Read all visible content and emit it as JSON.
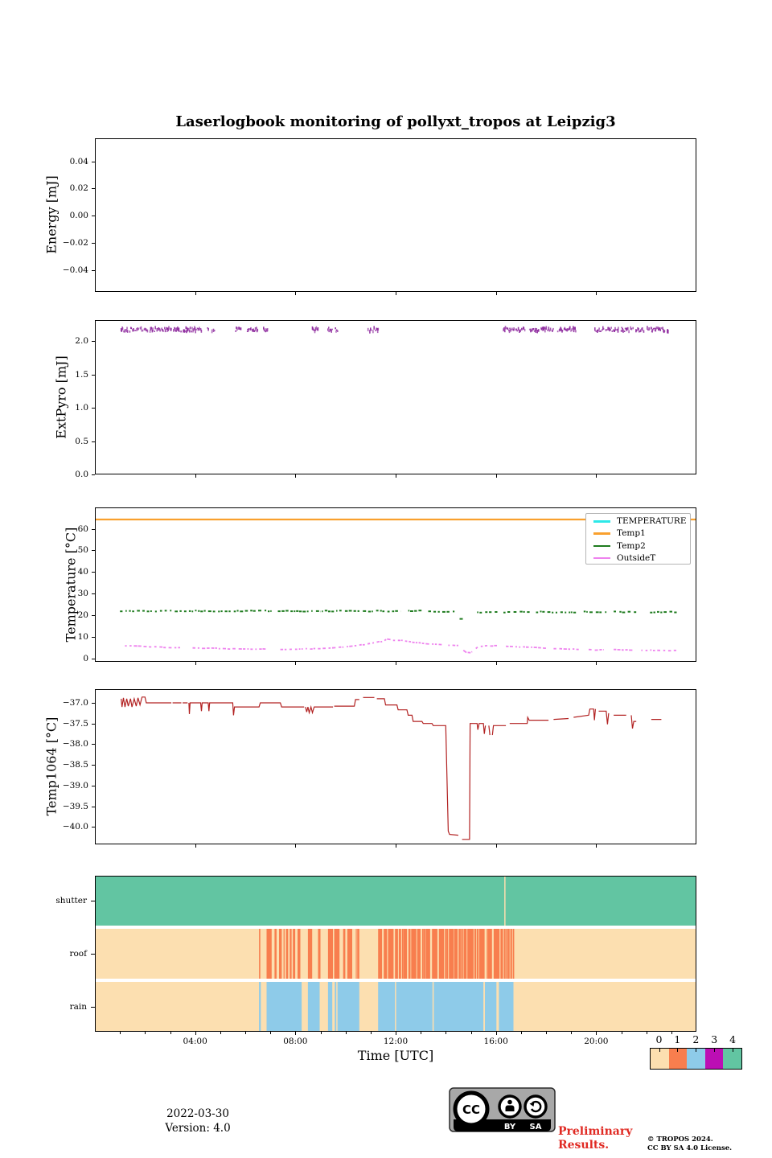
{
  "title": "Laserlogbook monitoring of pollyxt_tropos at Leipzig3",
  "footer": {
    "date": "2022-03-30",
    "version": "Version: 4.0",
    "preliminary_line1": "Preliminary",
    "preliminary_line2": "Results.",
    "copyright_line1": "© TROPOS 2024.",
    "copyright_line2": "CC BY SA 4.0 License.",
    "cc": {
      "cc": "CC",
      "by": "BY",
      "sa": "SA"
    }
  },
  "colorbar": {
    "labels": [
      "0",
      "1",
      "2",
      "3",
      "4"
    ],
    "colors": [
      "#fcdfb0",
      "#f87e4e",
      "#8ecbe9",
      "#bc0eb4",
      "#62c5a2"
    ]
  },
  "chart_data": [
    {
      "type": "line",
      "id": "energy",
      "ylabel": "Energy [mJ]",
      "yticks": {
        "values": [
          -0.04,
          -0.02,
          0.0,
          0.02,
          0.04
        ],
        "labels": [
          "−0.04",
          "−0.02",
          "0.00",
          "0.02",
          "0.04"
        ]
      },
      "ylim": [
        -0.057,
        0.057
      ],
      "xlim_hours": [
        0,
        24
      ],
      "series": []
    },
    {
      "type": "scatter",
      "id": "extpyro",
      "ylabel": "ExtPyro [mJ]",
      "yticks": {
        "values": [
          0.0,
          0.5,
          1.0,
          1.5,
          2.0
        ],
        "labels": [
          "0.0",
          "0.5",
          "1.0",
          "1.5",
          "2.0"
        ]
      },
      "ylim": [
        0,
        2.31
      ],
      "xlim_hours": [
        0,
        24
      ],
      "marker_color": "#8e2a9e",
      "value_band": [
        2.14,
        2.2
      ],
      "clusters": [
        [
          1.05,
          2.1
        ],
        [
          2.2,
          3.05
        ],
        [
          3.1,
          4.3
        ],
        [
          4.5,
          4.78
        ],
        [
          5.62,
          5.85
        ],
        [
          6.05,
          6.5
        ],
        [
          6.7,
          6.9
        ],
        [
          8.68,
          8.92
        ],
        [
          9.3,
          9.48
        ],
        [
          9.6,
          9.72
        ],
        [
          10.88,
          11.15
        ],
        [
          11.2,
          11.32
        ],
        [
          16.3,
          17.2
        ],
        [
          17.35,
          18.3
        ],
        [
          18.45,
          19.2
        ],
        [
          19.95,
          20.9
        ],
        [
          21.0,
          21.9
        ],
        [
          22.0,
          22.95
        ]
      ]
    },
    {
      "type": "line",
      "id": "temperature",
      "ylabel": "Temperature [°C]",
      "yticks": {
        "values": [
          0,
          10,
          20,
          30,
          40,
          50,
          60
        ],
        "labels": [
          "0",
          "10",
          "20",
          "30",
          "40",
          "50",
          "60"
        ]
      },
      "ylim": [
        -2,
        70
      ],
      "xlim_hours": [
        0,
        24
      ],
      "legend": [
        {
          "label": "TEMPERATURE",
          "color": "#2ee8e8"
        },
        {
          "label": "Temp1",
          "color": "#f9a02e"
        },
        {
          "label": "Temp2",
          "color": "#1e7b1e"
        },
        {
          "label": "OutsideT",
          "color": "#ee82ee"
        }
      ],
      "temp1_constant_value": 64.3,
      "temp2_segments": [
        [
          1.0,
          2.3,
          21.9
        ],
        [
          2.4,
          7.05,
          21.85
        ],
        [
          7.3,
          9.0,
          21.8
        ],
        [
          9.05,
          12.2,
          21.85
        ],
        [
          12.5,
          13.1,
          21.9
        ],
        [
          13.3,
          14.35,
          21.7
        ],
        [
          14.55,
          14.72,
          18.3
        ],
        [
          15.25,
          16.1,
          21.35
        ],
        [
          16.3,
          17.35,
          21.4
        ],
        [
          17.6,
          19.25,
          21.4
        ],
        [
          19.5,
          20.45,
          21.45
        ],
        [
          20.7,
          21.65,
          21.5
        ],
        [
          22.15,
          23.3,
          21.4
        ]
      ],
      "outsideT_base": [
        [
          1.2,
          5.8
        ],
        [
          1.7,
          5.6
        ],
        [
          2.2,
          5.3
        ],
        [
          2.8,
          5.0
        ],
        [
          3.3,
          4.8
        ],
        [
          4.0,
          4.7
        ],
        [
          4.7,
          4.6
        ],
        [
          5.3,
          4.4
        ],
        [
          6.0,
          4.2
        ],
        [
          6.6,
          4.3
        ],
        [
          7.2,
          4.0
        ],
        [
          7.8,
          4.2
        ],
        [
          8.3,
          4.3
        ],
        [
          8.8,
          4.4
        ],
        [
          9.3,
          4.6
        ],
        [
          9.8,
          5.0
        ],
        [
          10.3,
          5.6
        ],
        [
          10.8,
          6.4
        ],
        [
          11.1,
          7.0
        ],
        [
          11.35,
          7.6
        ],
        [
          11.5,
          7.8
        ],
        [
          11.65,
          8.9
        ],
        [
          11.9,
          8.4
        ],
        [
          12.2,
          8.3
        ],
        [
          12.6,
          7.6
        ],
        [
          13.0,
          7.0
        ],
        [
          13.4,
          6.6
        ],
        [
          13.8,
          6.3
        ],
        [
          14.2,
          6.0
        ],
        [
          14.5,
          5.8
        ],
        [
          14.8,
          2.7
        ],
        [
          15.0,
          2.5
        ],
        [
          15.3,
          5.4
        ],
        [
          15.6,
          5.7
        ],
        [
          16.0,
          5.8
        ],
        [
          16.4,
          5.6
        ],
        [
          16.9,
          5.3
        ],
        [
          17.4,
          5.1
        ],
        [
          17.9,
          4.8
        ],
        [
          18.4,
          4.5
        ],
        [
          18.9,
          4.3
        ],
        [
          19.4,
          4.1
        ],
        [
          19.9,
          3.8
        ],
        [
          20.4,
          4.0
        ],
        [
          20.9,
          3.9
        ],
        [
          21.4,
          3.8
        ],
        [
          21.9,
          3.6
        ],
        [
          22.4,
          3.7
        ],
        [
          22.9,
          3.5
        ],
        [
          23.3,
          3.5
        ]
      ],
      "outsideT_ranges": [
        [
          1.2,
          3.4
        ],
        [
          3.9,
          6.9
        ],
        [
          7.4,
          13.9
        ],
        [
          14.1,
          14.5
        ],
        [
          14.7,
          15.05
        ],
        [
          15.2,
          16.1
        ],
        [
          16.4,
          18.0
        ],
        [
          18.3,
          19.4
        ],
        [
          19.7,
          20.3
        ],
        [
          20.7,
          21.5
        ],
        [
          21.8,
          23.3
        ]
      ]
    },
    {
      "type": "line",
      "id": "temp1064",
      "ylabel": "Temp1064 [°C]",
      "yticks": {
        "values": [
          -40.0,
          -39.5,
          -39.0,
          -38.5,
          -38.0,
          -37.5,
          -37.0
        ],
        "labels": [
          "−40.0",
          "−39.5",
          "−39.0",
          "−38.5",
          "−38.0",
          "−37.5",
          "−37.0"
        ]
      },
      "ylim": [
        -40.45,
        -36.67
      ],
      "xlim_hours": [
        0,
        24
      ],
      "line_color": "#b22222",
      "points": [
        [
          1.05,
          -36.9
        ],
        [
          1.08,
          -37.1
        ],
        [
          1.14,
          -36.88
        ],
        [
          1.2,
          -37.1
        ],
        [
          1.27,
          -36.9
        ],
        [
          1.33,
          -37.08
        ],
        [
          1.42,
          -36.9
        ],
        [
          1.48,
          -37.1
        ],
        [
          1.57,
          -36.9
        ],
        [
          1.65,
          -37.08
        ],
        [
          1.72,
          -36.88
        ],
        [
          1.8,
          -37.05
        ],
        [
          1.88,
          -36.86
        ],
        [
          2.0,
          -36.86
        ],
        [
          2.05,
          -37.0
        ],
        [
          3.05,
          -37.0
        ],
        null,
        [
          3.1,
          -37.0
        ],
        [
          3.45,
          -37.0
        ],
        null,
        [
          3.5,
          -37.0
        ],
        [
          3.7,
          -37.0
        ],
        null,
        [
          3.75,
          -37.0
        ],
        [
          3.77,
          -37.27
        ],
        [
          3.8,
          -37.0
        ],
        [
          4.22,
          -37.0
        ],
        [
          4.25,
          -37.2
        ],
        [
          4.28,
          -37.0
        ],
        [
          4.52,
          -37.0
        ],
        [
          4.55,
          -37.2
        ],
        [
          4.58,
          -37.0
        ],
        [
          5.5,
          -37.0
        ],
        [
          5.53,
          -37.3
        ],
        [
          5.57,
          -37.1
        ],
        [
          6.55,
          -37.1
        ],
        [
          6.6,
          -37.0
        ],
        [
          7.4,
          -37.0
        ],
        [
          7.45,
          -37.1
        ],
        [
          8.35,
          -37.1
        ],
        null,
        [
          8.4,
          -37.1
        ],
        [
          8.45,
          -37.22
        ],
        [
          8.5,
          -37.1
        ],
        [
          8.55,
          -37.24
        ],
        [
          8.62,
          -37.1
        ],
        [
          8.68,
          -37.24
        ],
        [
          8.75,
          -37.1
        ],
        [
          9.5,
          -37.1
        ],
        null,
        [
          9.55,
          -37.08
        ],
        [
          10.35,
          -37.08
        ],
        [
          10.4,
          -36.92
        ],
        [
          10.55,
          -36.92
        ],
        null,
        [
          10.7,
          -36.87
        ],
        [
          11.15,
          -36.87
        ],
        null,
        [
          11.25,
          -36.9
        ],
        [
          11.55,
          -36.9
        ],
        [
          11.6,
          -37.05
        ],
        [
          12.05,
          -37.05
        ],
        [
          12.1,
          -37.17
        ],
        [
          12.45,
          -37.17
        ],
        [
          12.5,
          -37.3
        ],
        [
          12.65,
          -37.3
        ],
        [
          12.7,
          -37.45
        ],
        [
          13.05,
          -37.45
        ],
        [
          13.1,
          -37.5
        ],
        [
          13.45,
          -37.5
        ],
        [
          13.5,
          -37.55
        ],
        [
          14.0,
          -37.55
        ],
        [
          14.1,
          -40.1
        ],
        [
          14.15,
          -40.18
        ],
        [
          14.5,
          -40.2
        ],
        null,
        [
          14.65,
          -40.3
        ],
        [
          14.95,
          -40.3
        ],
        [
          14.97,
          -37.5
        ],
        [
          15.25,
          -37.5
        ],
        [
          15.28,
          -37.65
        ],
        [
          15.33,
          -37.5
        ],
        [
          15.5,
          -37.5
        ],
        [
          15.54,
          -37.75
        ],
        [
          15.58,
          -37.55
        ],
        null,
        [
          15.72,
          -37.55
        ],
        [
          15.76,
          -37.78
        ],
        null,
        [
          15.86,
          -37.78
        ],
        [
          15.9,
          -37.55
        ],
        [
          16.4,
          -37.55
        ],
        null,
        [
          16.55,
          -37.5
        ],
        [
          17.25,
          -37.5
        ],
        [
          17.27,
          -37.35
        ],
        [
          17.33,
          -37.42
        ],
        [
          18.1,
          -37.42
        ],
        null,
        [
          18.3,
          -37.4
        ],
        [
          18.9,
          -37.38
        ],
        null,
        [
          19.1,
          -37.35
        ],
        [
          19.7,
          -37.3
        ],
        [
          19.75,
          -37.15
        ],
        [
          19.9,
          -37.15
        ],
        [
          19.93,
          -37.42
        ],
        [
          19.97,
          -37.15
        ],
        null,
        [
          20.1,
          -37.2
        ],
        [
          20.4,
          -37.2
        ],
        [
          20.45,
          -37.52
        ],
        [
          20.5,
          -37.25
        ],
        null,
        [
          20.7,
          -37.3
        ],
        [
          21.2,
          -37.3
        ],
        null,
        [
          21.4,
          -37.3
        ],
        [
          21.45,
          -37.62
        ],
        [
          21.5,
          -37.45
        ],
        [
          21.6,
          -37.45
        ],
        null,
        [
          22.2,
          -37.4
        ],
        [
          22.6,
          -37.4
        ]
      ]
    },
    {
      "type": "heatmap",
      "id": "status",
      "rows": [
        "shutter",
        "roof",
        "rain"
      ],
      "xlabel": "Time [UTC]",
      "xtick_labels": [
        "04:00",
        "08:00",
        "12:00",
        "16:00",
        "20:00"
      ],
      "xtick_hours": [
        4,
        8,
        12,
        16,
        20
      ],
      "xlim_hours": [
        0,
        24
      ],
      "shutter": {
        "value": 4,
        "gap_line_hour": 16.36
      },
      "roof": {
        "background_value": 0,
        "stripe_value": 1,
        "stripe_regions": [
          [
            6.55,
            6.6,
            1.0
          ],
          [
            6.85,
            8.2,
            0.55
          ],
          [
            8.5,
            9.0,
            0.45
          ],
          [
            9.3,
            10.55,
            0.6
          ],
          [
            11.3,
            16.73,
            0.78
          ]
        ]
      },
      "rain": {
        "background_value": 0,
        "fill_value": 2,
        "segments": [
          [
            6.55,
            6.62
          ],
          [
            6.85,
            8.25
          ],
          [
            8.5,
            8.97
          ],
          [
            9.3,
            9.47
          ],
          [
            9.57,
            9.63
          ],
          [
            9.68,
            10.55
          ],
          [
            11.3,
            11.97
          ],
          [
            12.02,
            13.47
          ],
          [
            13.52,
            15.5
          ],
          [
            15.56,
            16.02
          ],
          [
            16.12,
            16.7
          ]
        ]
      }
    }
  ]
}
